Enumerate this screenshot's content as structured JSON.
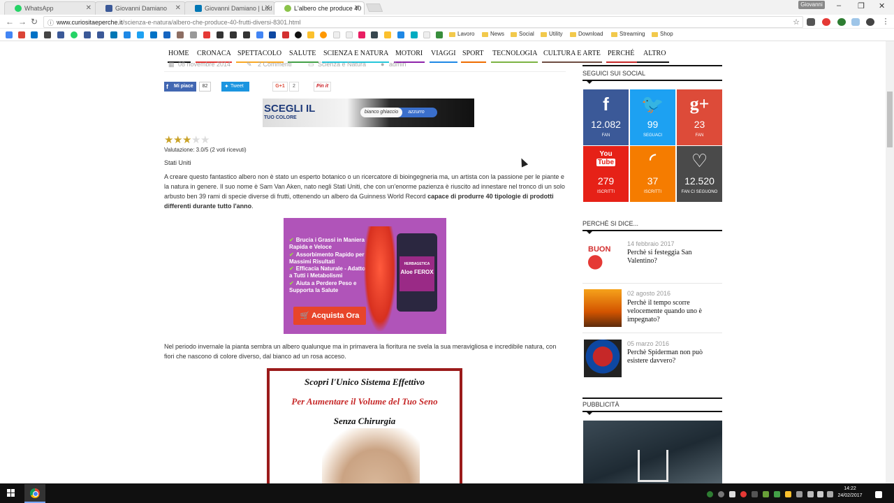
{
  "browser": {
    "tabs": [
      {
        "title": "WhatsApp",
        "color": "#25d366"
      },
      {
        "title": "Giovanni Damiano",
        "color": "#3b5998"
      },
      {
        "title": "Giovanni Damiano | Lud",
        "color": "#0077b5"
      },
      {
        "title": "L'albero che produce 40",
        "color": "#8bc34a"
      }
    ],
    "profile": "Giovanni",
    "url_host": "www.curiositaeperche.it",
    "url_path": "/scienza-e-natura/albero-che-produce-40-frutti-diversi-8301.html",
    "bookmark_folders": [
      "Lavoro",
      "News",
      "Social",
      "Utility",
      "Download",
      "Streaming",
      "Shop"
    ]
  },
  "site": {
    "nav": [
      {
        "label": "HOME",
        "color": "#111111"
      },
      {
        "label": "CRONACA",
        "color": "#e53935"
      },
      {
        "label": "SPETTACOLO",
        "color": "#f9a825"
      },
      {
        "label": "SALUTE",
        "color": "#43a047"
      },
      {
        "label": "SCIENZA E NATURA",
        "color": "#26c6da"
      },
      {
        "label": "MOTORI",
        "color": "#8e24aa"
      },
      {
        "label": "VIAGGI",
        "color": "#1e88e5"
      },
      {
        "label": "SPORT",
        "color": "#ef6c00"
      },
      {
        "label": "TECNOLOGIA",
        "color": "#7cb342"
      },
      {
        "label": "CULTURA E ARTE",
        "color": "#6d4c41"
      },
      {
        "label": "PERCHÉ",
        "color": "#c62828"
      },
      {
        "label": "ALTRO",
        "color": "#111111"
      }
    ]
  },
  "article": {
    "meta": {
      "date": "08 novembre 2014",
      "comments": "2 Commenti",
      "category": "Scienza e Natura",
      "author": "admin"
    },
    "social": {
      "like_label": "Mi piace",
      "like_count": "82",
      "tweet_label": "Tweet",
      "gplus_label": "G+1",
      "gplus_count": "2",
      "pin_label": "Pin it"
    },
    "banner": {
      "line1": "SCEGLI IL",
      "line2": "TUO COLORE",
      "option1": "bianco ghiaccio",
      "option2": "azzurro"
    },
    "rating": {
      "value": 3,
      "max": 5,
      "text": "Valutazione: 3.0/5 (2 voti ricevuti)"
    },
    "location": "Stati Uniti",
    "para1": "A creare questo fantastico albero non è stato un esperto botanico o un ricercatore di bioingegneria ma, un artista con la passione per le piante e la natura in genere. Il suo nome è Sam Van Aken, nato negli Stati Uniti, che con un'enorme pazienza è riuscito ad innestare nel tronco di un solo arbusto ben 39 rami di specie diverse di frutti, ottenendo un albero da Guinness World Record",
    "para1_bold": "capace di produrre 40 tipologie di prodotti differenti durante tutto l'anno",
    "para2": "Nel periodo invernale la pianta sembra un albero qualunque ma in primavera la fioritura ne svela la sua meravigliosa e incredibile natura, con fiori che nascono di colore diverso, dal bianco ad un rosa acceso.",
    "ad_aloe": {
      "bullets": [
        "Brucia i Grassi in Maniera Rapida e Veloce",
        "Assorbimento Rapido per Massimi Risultati",
        "Efficacia Naturale - Adatto a Tutti i Metabolismi",
        "Aiuta a Perdere Peso e Supporta la Salute"
      ],
      "brand": "HERBAGETICA",
      "product": "Aloe FEROX",
      "cta": "Acquista Ora"
    },
    "ad_seno": {
      "line1": "Scopri l'Unico Sistema Effettivo",
      "line2": "Per Aumentare il Volume del Tuo Seno",
      "line3": "Senza Chirurgia"
    }
  },
  "sidebar": {
    "social_title": "SEGUICI SUI SOCIAL",
    "tiles": [
      {
        "icon": "f",
        "count": "12.082",
        "label": "FAN",
        "color": "#3b5998"
      },
      {
        "icon": "t",
        "count": "99",
        "label": "SEGUACI",
        "color": "#1da1f2"
      },
      {
        "icon": "g+",
        "count": "23",
        "label": "FAN",
        "color": "#dd4b39"
      },
      {
        "icon": "You Tube",
        "count": "279",
        "label": "ISCRITTI",
        "color": "#e62117"
      },
      {
        "icon": "rss",
        "count": "37",
        "label": "ISCRITTI",
        "color": "#f57c00"
      },
      {
        "icon": "heart",
        "count": "12.520",
        "label": "FAN CI SEGUONO",
        "color": "#4a4a4a"
      }
    ],
    "posts_title": "PERCHÉ SI DICE...",
    "posts": [
      {
        "date": "14 febbraio 2017",
        "title": "Perchè si festeggia San Valentino?"
      },
      {
        "date": "02 agosto 2016",
        "title": "Perchè il tempo scorre velocemente quando uno è impegnato?"
      },
      {
        "date": "05 marzo 2016",
        "title": "Perchè Spiderman non può esistere davvero?"
      }
    ],
    "ads_title": "PUBBLICITÀ"
  },
  "taskbar": {
    "time": "14:22",
    "date": "24/02/2017"
  }
}
